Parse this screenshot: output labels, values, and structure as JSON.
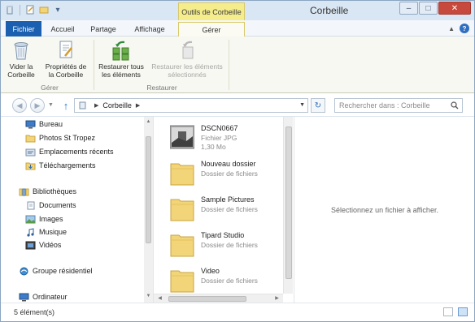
{
  "window": {
    "title": "Corbeille",
    "context_tab_title": "Outils de Corbeille"
  },
  "ribbon_tabs": [
    {
      "label": "Fichier"
    },
    {
      "label": "Accueil"
    },
    {
      "label": "Partage"
    },
    {
      "label": "Affichage"
    },
    {
      "label": "Gérer"
    }
  ],
  "ribbon": {
    "empty_bin": "Vider la\nCorbeille",
    "bin_properties": "Propriétés de\nla Corbeille",
    "group_manage": "Gérer",
    "restore_all": "Restaurer tous\nles éléments",
    "restore_selected": "Restaurer les éléments\nsélectionnés",
    "group_restore": "Restaurer"
  },
  "address": {
    "path": "Corbeille",
    "search_placeholder": "Rechercher dans : Corbeille"
  },
  "nav": {
    "items": [
      {
        "label": "Bureau",
        "icon": "desktop-icon"
      },
      {
        "label": "Photos St Tropez",
        "icon": "folder-icon"
      },
      {
        "label": "Emplacements récents",
        "icon": "recent-places-icon"
      },
      {
        "label": "Téléchargements",
        "icon": "downloads-icon"
      },
      {
        "label": "Bibliothèques",
        "icon": "libraries-icon"
      },
      {
        "label": "Documents",
        "icon": "documents-icon"
      },
      {
        "label": "Images",
        "icon": "pictures-icon"
      },
      {
        "label": "Musique",
        "icon": "music-icon"
      },
      {
        "label": "Vidéos",
        "icon": "videos-icon"
      },
      {
        "label": "Groupe résidentiel",
        "icon": "homegroup-icon"
      },
      {
        "label": "Ordinateur",
        "icon": "computer-icon"
      }
    ]
  },
  "files": [
    {
      "name": "DSCN0667",
      "type": "Fichier JPG",
      "size": "1,30 Mo",
      "icon": "photo-thumbnail"
    },
    {
      "name": "Nouveau dossier",
      "type": "Dossier de fichiers",
      "icon": "folder-icon"
    },
    {
      "name": "Sample Pictures",
      "type": "Dossier de fichiers",
      "icon": "folder-icon"
    },
    {
      "name": "Tipard Studio",
      "type": "Dossier de fichiers",
      "icon": "folder-icon"
    },
    {
      "name": "Video",
      "type": "Dossier de fichiers",
      "icon": "folder-icon"
    }
  ],
  "preview": {
    "message": "Sélectionnez un fichier à afficher."
  },
  "status": {
    "count": "5 élément(s)"
  },
  "colors": {
    "accent_blue": "#1b5fb0",
    "context_tab_yellow": "#f5ec8c",
    "folder_yellow": "#f2d479",
    "close_red": "#c7493d"
  }
}
